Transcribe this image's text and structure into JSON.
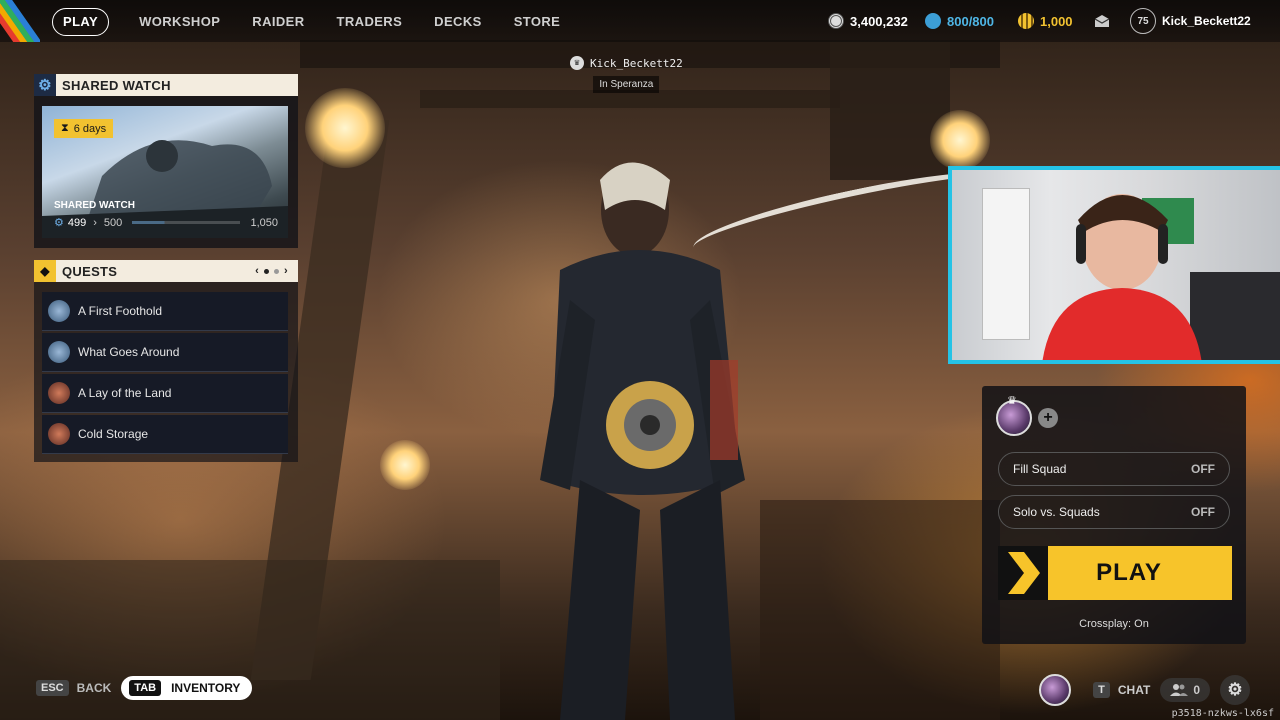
{
  "nav": {
    "items": [
      {
        "label": "PLAY",
        "active": true
      },
      {
        "label": "WORKSHOP",
        "active": false
      },
      {
        "label": "RAIDER",
        "active": false
      },
      {
        "label": "TRADERS",
        "active": false
      },
      {
        "label": "DECKS",
        "active": false
      },
      {
        "label": "STORE",
        "active": false
      }
    ]
  },
  "currencies": {
    "coins": "3,400,232",
    "credits": "800/800",
    "tokens": "1,000"
  },
  "profile": {
    "level": "75",
    "username": "Kick_Beckett22"
  },
  "player_tag": {
    "name": "Kick_Beckett22",
    "location": "In Speranza"
  },
  "shared_watch": {
    "header": "SHARED WATCH",
    "timer": "6 days",
    "title": "SHARED WATCH",
    "current": "499",
    "next": "500",
    "max": "1,050"
  },
  "quests": {
    "header": "QUESTS",
    "items": [
      {
        "label": "A First Foothold",
        "icon": "globe-icon"
      },
      {
        "label": "What Goes Around",
        "icon": "globe-icon"
      },
      {
        "label": "A Lay of the Land",
        "icon": "faction-icon"
      },
      {
        "label": "Cold Storage",
        "icon": "faction-icon"
      }
    ]
  },
  "squad": {
    "fill_squad_label": "Fill Squad",
    "fill_squad_value": "OFF",
    "solo_label": "Solo vs. Squads",
    "solo_value": "OFF",
    "play_label": "PLAY",
    "crossplay": "Crossplay: On"
  },
  "bottom": {
    "esc_key": "ESC",
    "back_label": "BACK",
    "tab_key": "TAB",
    "inventory_label": "INVENTORY",
    "chat_key": "T",
    "chat_label": "CHAT",
    "friends_count": "0"
  },
  "session_id": "p3518-nzkws-lx6sf",
  "colors": {
    "accent_yellow": "#f7c42a",
    "webcam_border": "#25c3e6",
    "panel_header": "#f3ecdf"
  }
}
